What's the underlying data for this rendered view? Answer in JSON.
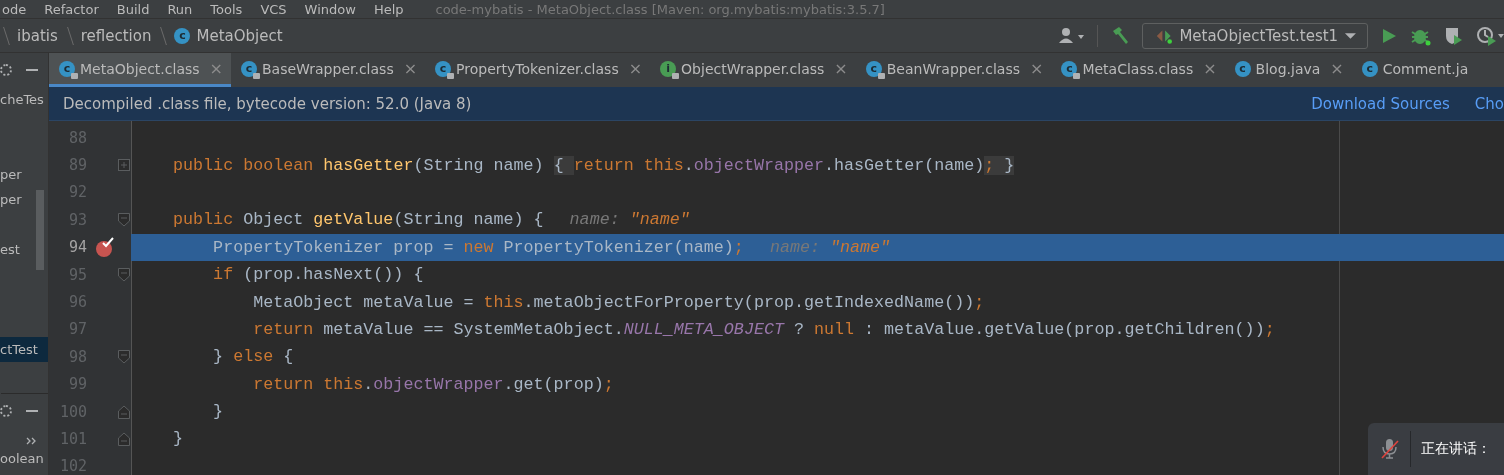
{
  "menu_bar": {
    "items": [
      "ode",
      "Refactor",
      "Build",
      "Run",
      "Tools",
      "VCS",
      "Window",
      "Help"
    ],
    "title": "code-mybatis - MetaObject.class [Maven: org.mybatis:mybatis:3.5.7]"
  },
  "breadcrumbs": [
    {
      "label": "ibatis"
    },
    {
      "label": "reflection"
    },
    {
      "label": "MetaObject",
      "icon": "c"
    }
  ],
  "toolbar": {
    "run_config": "MetaObjectTest.test1"
  },
  "tabs": [
    {
      "label": "MetaObject.class",
      "icon": "c",
      "locked": true,
      "selected": true,
      "close": "×"
    },
    {
      "label": "BaseWrapper.class",
      "icon": "c",
      "locked": true,
      "selected": false,
      "close": "×"
    },
    {
      "label": "PropertyTokenizer.class",
      "icon": "c",
      "locked": true,
      "selected": false,
      "close": "×"
    },
    {
      "label": "ObjectWrapper.class",
      "icon": "i",
      "locked": true,
      "selected": false,
      "close": "×"
    },
    {
      "label": "BeanWrapper.class",
      "icon": "c",
      "locked": true,
      "selected": false,
      "close": "×"
    },
    {
      "label": "MetaClass.class",
      "icon": "c",
      "locked": true,
      "selected": false,
      "close": "×"
    },
    {
      "label": "Blog.java",
      "icon": "c",
      "locked": false,
      "selected": false,
      "close": "×"
    },
    {
      "label": "Comment.ja",
      "icon": "c",
      "locked": false,
      "selected": false
    }
  ],
  "banner": {
    "message": "Decompiled .class file, bytecode version: 52.0 (Java 8)",
    "links": [
      "Download Sources",
      "Cho"
    ]
  },
  "project_panel": {
    "items": [
      {
        "label": "cheTes",
        "selected": false
      },
      {
        "label": "per",
        "selected": false
      },
      {
        "label": "per",
        "selected": false
      },
      {
        "label": "est",
        "selected": false
      },
      {
        "label": "ctTest",
        "selected": true
      }
    ],
    "lower_items": [
      "oolean"
    ]
  },
  "editor": {
    "lines": [
      {
        "number": "88",
        "folded": false,
        "fold_start": false,
        "fold_end": false,
        "breakpoint": false,
        "current": false
      },
      {
        "number": "89",
        "folded": true,
        "fold_start": false,
        "fold_end": false,
        "breakpoint": false,
        "current": false,
        "tokens": [
          {
            "kind": "kw",
            "text": "    public boolean "
          },
          {
            "kind": "method",
            "text": "hasGetter"
          },
          {
            "kind": "plain",
            "text": "(String name) "
          },
          {
            "kind": "fold",
            "text": "{ "
          },
          {
            "kind": "kw",
            "text": "return this"
          },
          {
            "kind": "plain",
            "text": "."
          },
          {
            "kind": "field",
            "text": "objectWrapper"
          },
          {
            "kind": "plain",
            "text": ".hasGetter(name)"
          },
          {
            "kind": "fold-kw",
            "text": ";"
          },
          {
            "kind": "fold",
            "text": " }"
          }
        ]
      },
      {
        "number": "92",
        "folded": false,
        "fold_start": false,
        "fold_end": false,
        "breakpoint": false,
        "current": false
      },
      {
        "number": "93",
        "folded": false,
        "fold_start": true,
        "fold_end": false,
        "breakpoint": false,
        "current": false,
        "tokens": [
          {
            "kind": "kw",
            "text": "    public "
          },
          {
            "kind": "plain",
            "text": "Object "
          },
          {
            "kind": "method",
            "text": "getValue"
          },
          {
            "kind": "plain",
            "text": "(String name) {"
          },
          {
            "kind": "hint",
            "text": "name: "
          },
          {
            "kind": "hint-value",
            "text": "\"name\""
          }
        ]
      },
      {
        "number": "94",
        "folded": false,
        "fold_start": false,
        "fold_end": false,
        "breakpoint": true,
        "current": true,
        "tokens": [
          {
            "kind": "plain",
            "text": "        PropertyTokenizer prop = "
          },
          {
            "kind": "kw",
            "text": "new "
          },
          {
            "kind": "plain",
            "text": "PropertyTokenizer(name)"
          },
          {
            "kind": "kw",
            "text": ";"
          },
          {
            "kind": "hint",
            "text": "name: "
          },
          {
            "kind": "hint-value",
            "text": "\"name\""
          }
        ]
      },
      {
        "number": "95",
        "folded": false,
        "fold_start": true,
        "fold_end": false,
        "breakpoint": false,
        "current": false,
        "tokens": [
          {
            "kind": "kw",
            "text": "        if "
          },
          {
            "kind": "plain",
            "text": "(prop.hasNext()) {"
          }
        ]
      },
      {
        "number": "96",
        "folded": false,
        "fold_start": false,
        "fold_end": false,
        "breakpoint": false,
        "current": false,
        "tokens": [
          {
            "kind": "plain",
            "text": "            MetaObject metaValue = "
          },
          {
            "kind": "kw",
            "text": "this"
          },
          {
            "kind": "plain",
            "text": ".metaObjectForProperty(prop.getIndexedName())"
          },
          {
            "kind": "kw",
            "text": ";"
          }
        ]
      },
      {
        "number": "97",
        "folded": false,
        "fold_start": false,
        "fold_end": false,
        "breakpoint": false,
        "current": false,
        "tokens": [
          {
            "kind": "kw",
            "text": "            return "
          },
          {
            "kind": "plain",
            "text": "metaValue == SystemMetaObject."
          },
          {
            "kind": "static",
            "text": "NULL_META_OBJECT"
          },
          {
            "kind": "plain",
            "text": " ? "
          },
          {
            "kind": "kw",
            "text": "null "
          },
          {
            "kind": "plain",
            "text": ": metaValue.getValue(prop.getChildren())"
          },
          {
            "kind": "kw",
            "text": ";"
          }
        ]
      },
      {
        "number": "98",
        "folded": false,
        "fold_start": true,
        "fold_end": false,
        "breakpoint": false,
        "current": false,
        "tokens": [
          {
            "kind": "plain",
            "text": "        } "
          },
          {
            "kind": "kw",
            "text": "else "
          },
          {
            "kind": "plain",
            "text": "{"
          }
        ]
      },
      {
        "number": "99",
        "folded": false,
        "fold_start": false,
        "fold_end": false,
        "breakpoint": false,
        "current": false,
        "tokens": [
          {
            "kind": "kw",
            "text": "            return this"
          },
          {
            "kind": "plain",
            "text": "."
          },
          {
            "kind": "field",
            "text": "objectWrapper"
          },
          {
            "kind": "plain",
            "text": ".get(prop)"
          },
          {
            "kind": "kw",
            "text": ";"
          }
        ]
      },
      {
        "number": "100",
        "folded": false,
        "fold_start": false,
        "fold_end": true,
        "breakpoint": false,
        "current": false,
        "tokens": [
          {
            "kind": "plain",
            "text": "        }"
          }
        ]
      },
      {
        "number": "101",
        "folded": false,
        "fold_start": false,
        "fold_end": true,
        "breakpoint": false,
        "current": false,
        "tokens": [
          {
            "kind": "plain",
            "text": "    }"
          }
        ]
      },
      {
        "number": "102",
        "folded": false,
        "fold_start": false,
        "fold_end": false,
        "breakpoint": false,
        "current": false
      }
    ]
  },
  "notification": {
    "text": "正在讲话：",
    "muted": true
  }
}
